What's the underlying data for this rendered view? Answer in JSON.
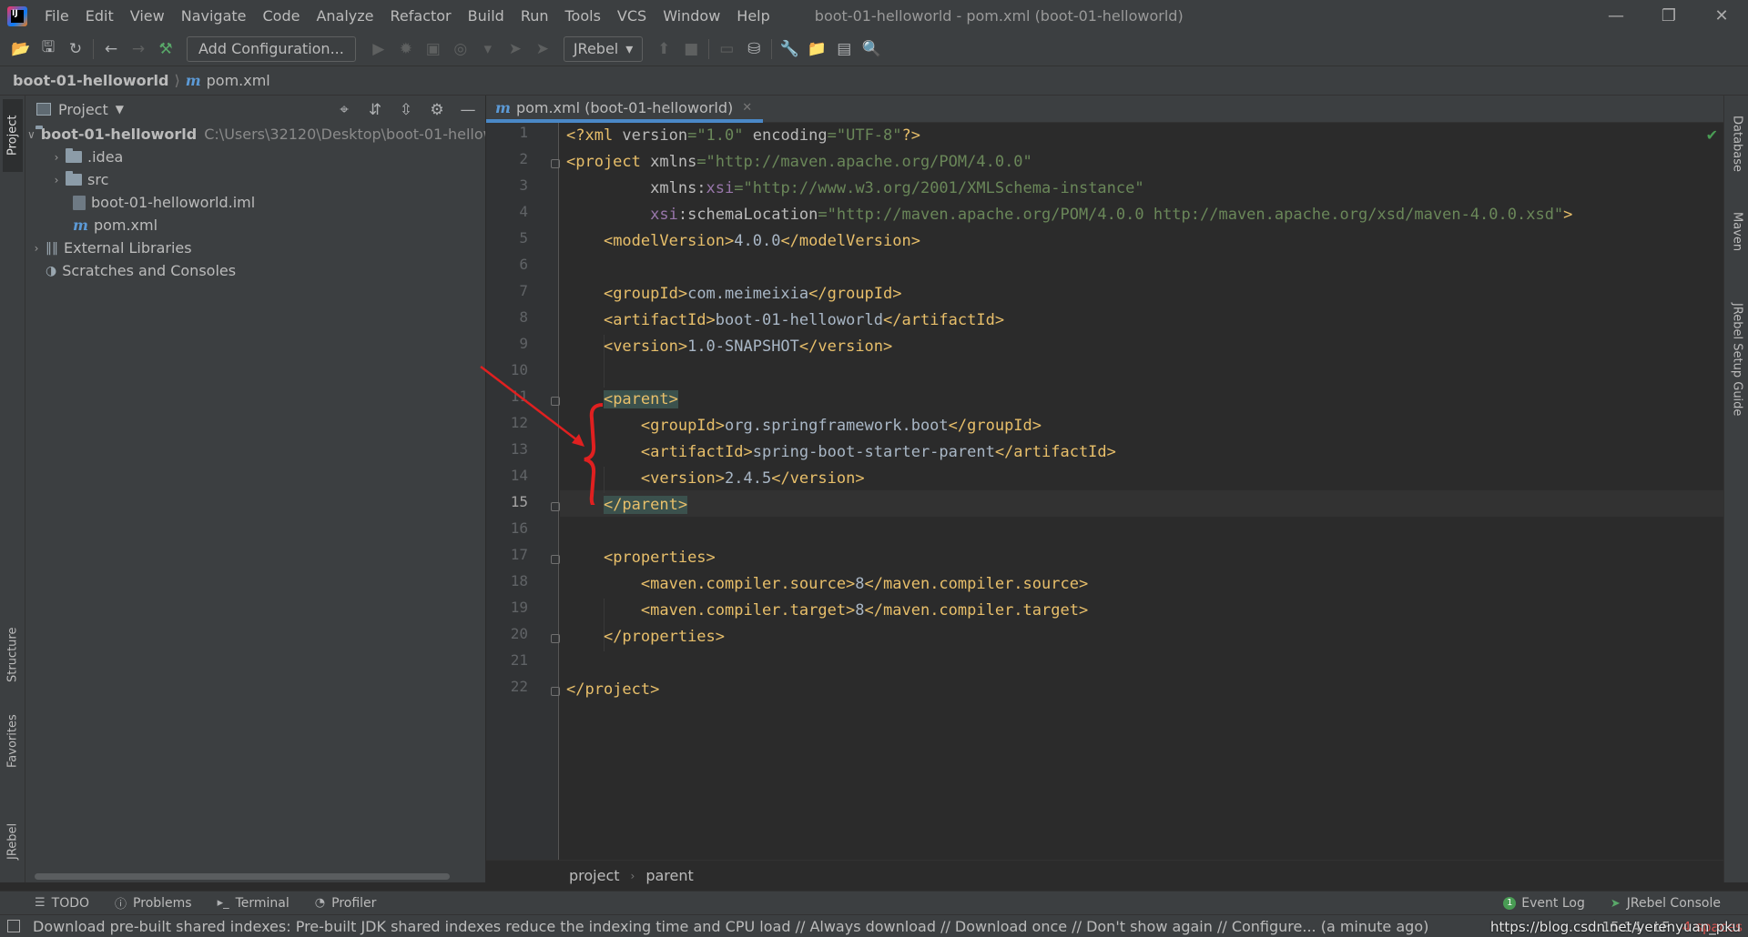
{
  "menubar": {
    "items": [
      "File",
      "Edit",
      "View",
      "Navigate",
      "Code",
      "Analyze",
      "Refactor",
      "Build",
      "Run",
      "Tools",
      "VCS",
      "Window",
      "Help"
    ],
    "window_title": "boot-01-helloworld - pom.xml (boot-01-helloworld)"
  },
  "toolbar": {
    "add_configuration": "Add Configuration...",
    "jrebel_label": "JRebel"
  },
  "breadcrumb": {
    "project": "boot-01-helloworld",
    "file": "pom.xml"
  },
  "left_stripe": {
    "project": "Project",
    "structure": "Structure",
    "favorites": "Favorites",
    "jrebel": "JRebel"
  },
  "right_stripe": {
    "database": "Database",
    "maven": "Maven",
    "jrebel_guide": "JRebel Setup Guide"
  },
  "project_panel": {
    "title": "Project",
    "root_name": "boot-01-helloworld",
    "root_path": "C:\\Users\\32120\\Desktop\\boot-01-hellow",
    "idea": ".idea",
    "src": "src",
    "iml": "boot-01-helloworld.iml",
    "pom": "pom.xml",
    "external_libraries": "External Libraries",
    "scratches": "Scratches and Consoles"
  },
  "editor": {
    "tab_label": "pom.xml (boot-01-helloworld)",
    "current_line": 15,
    "line_numbers": [
      "1",
      "2",
      "3",
      "4",
      "5",
      "6",
      "7",
      "8",
      "9",
      "10",
      "11",
      "12",
      "13",
      "14",
      "15",
      "16",
      "17",
      "18",
      "19",
      "20",
      "21",
      "22"
    ],
    "crumbs": [
      "project",
      "parent"
    ]
  },
  "bottom_tabs": {
    "todo": "TODO",
    "problems": "Problems",
    "terminal": "Terminal",
    "profiler": "Profiler",
    "event_log": "Event Log",
    "event_log_count": "1",
    "jrebel_console": "JRebel Console"
  },
  "status": {
    "message": "Download pre-built shared indexes: Pre-built JDK shared indexes reduce the indexing time and CPU load // Always download // Download once // Don't show again // Configure... (a minute ago)",
    "position": "15:14",
    "line_sep": "LF",
    "spaces": "4 spaces",
    "watermark": "https://blog.csdn.net/yerenyuan_pku"
  },
  "colors": {
    "background": "#2b2b2b",
    "panel": "#3c3f41",
    "tag": "#e8bf6a",
    "string": "#6a8759",
    "annotation": "#e02020"
  }
}
